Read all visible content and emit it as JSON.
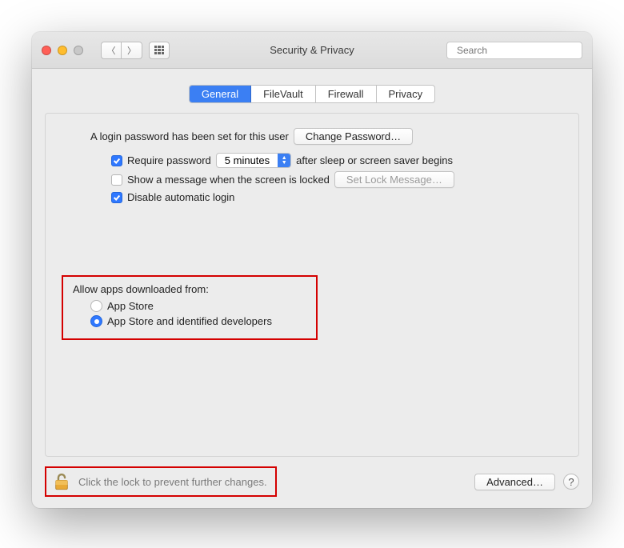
{
  "window": {
    "title": "Security & Privacy"
  },
  "search": {
    "placeholder": "Search"
  },
  "tabs": [
    {
      "label": "General",
      "active": true
    },
    {
      "label": "FileVault",
      "active": false
    },
    {
      "label": "Firewall",
      "active": false
    },
    {
      "label": "Privacy",
      "active": false
    }
  ],
  "general": {
    "login_password_text": "A login password has been set for this user",
    "change_password_btn": "Change Password…",
    "require_password": {
      "checked": true,
      "label_before": "Require password",
      "delay": "5 minutes",
      "label_after": "after sleep or screen saver begins"
    },
    "show_message": {
      "checked": false,
      "label": "Show a message when the screen is locked",
      "button": "Set Lock Message…"
    },
    "disable_auto_login": {
      "checked": true,
      "label": "Disable automatic login"
    },
    "allow_from": {
      "heading": "Allow apps downloaded from:",
      "options": [
        {
          "label": "App Store",
          "selected": false
        },
        {
          "label": "App Store and identified developers",
          "selected": true
        }
      ]
    }
  },
  "footer": {
    "lock_text": "Click the lock to prevent further changes.",
    "advanced_btn": "Advanced…",
    "help": "?"
  }
}
